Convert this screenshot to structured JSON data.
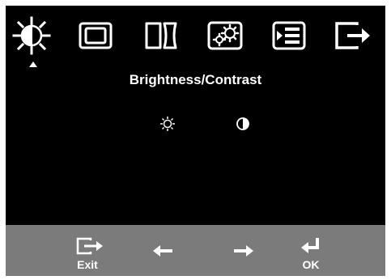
{
  "osd": {
    "background_color": "#000000",
    "bar_color": "#7b7b7b",
    "text_color": "#ffffff",
    "tabs": [
      {
        "icon": "brightness-icon",
        "selected": true
      },
      {
        "icon": "image-position-icon",
        "selected": false
      },
      {
        "icon": "image-setup-icon",
        "selected": false
      },
      {
        "icon": "image-properties-icon",
        "selected": false
      },
      {
        "icon": "options-icon",
        "selected": false
      },
      {
        "icon": "exit-icon",
        "selected": false
      }
    ],
    "title": "Brightness/Contrast",
    "sub_items": [
      {
        "icon": "brightness-sun-icon"
      },
      {
        "icon": "contrast-icon"
      }
    ],
    "controls": {
      "exit_label": "Exit",
      "ok_label": "OK",
      "left_icon": "arrow-left-icon",
      "right_icon": "arrow-right-icon",
      "enter_icon": "enter-icon"
    }
  }
}
